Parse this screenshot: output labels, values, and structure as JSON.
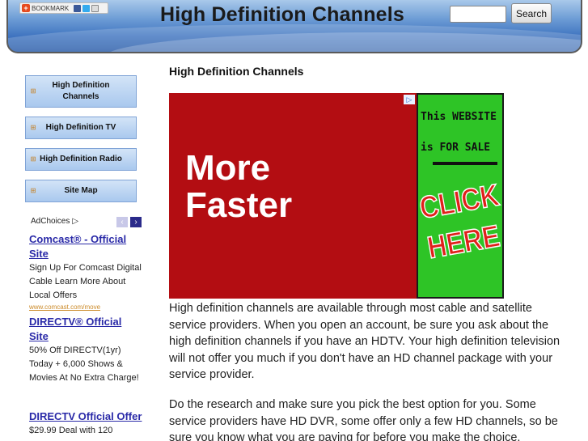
{
  "header": {
    "bookmark_label": "BOOKMARK",
    "title": "High Definition Channels",
    "search_placeholder": "",
    "search_button": "Search"
  },
  "sidebar": {
    "nav": [
      {
        "label": "High Definition Channels"
      },
      {
        "label": "High Definition TV"
      },
      {
        "label": "High Definition Radio"
      },
      {
        "label": "Site Map"
      }
    ],
    "adchoices_label": "AdChoices",
    "ads": [
      {
        "title": "Comcast® - Official Site",
        "body": "Sign Up For Comcast Digital Cable Learn More About Local Offers",
        "url": "www.comcast.com/move"
      },
      {
        "title": "DIRECTV® Official Site",
        "body": "50% Off DIRECTV(1yr) Today + 6,000 Shows & Movies At No Extra Charge!",
        "url": ""
      },
      {
        "title": "DIRECTV Official Offer",
        "body": "$29.99 Deal with 120",
        "url": ""
      }
    ]
  },
  "main": {
    "title": "High Definition Channels",
    "banner": {
      "headline_line1": "More",
      "headline_line2": "Faster",
      "side_line1": "This WEBSITE",
      "side_line2": "is FOR SALE",
      "side_cta_line1": "CLICK",
      "side_cta_line2": "HERE"
    },
    "paragraphs": [
      "High definition channels are available through most cable and satellite service providers. When you open an account, be sure you ask about the high definition channels if you have an HDTV. Your high definition television will not offer you much if you don't have an HD channel package with your service provider.",
      "Do the research and make sure you pick the best option for you. Some service providers have HD DVR, some offer only a few HD channels, so be sure you know what you are paying for before you make the choice."
    ]
  },
  "colors": {
    "header_blue": "#3f74c0",
    "nav_bg": "#b7d1f1",
    "ad_link": "#2a2aa8",
    "banner_red": "#b30d12",
    "sale_green": "#2ec426"
  }
}
